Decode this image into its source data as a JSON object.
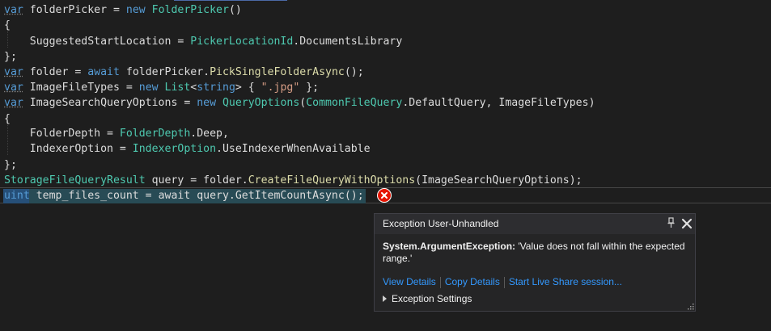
{
  "editor": {
    "lines": [
      {
        "tokens": [
          {
            "t": "var",
            "c": "squiggle-kw"
          },
          {
            "t": " folderPicker = ",
            "c": "plain"
          },
          {
            "t": "new",
            "c": "kw"
          },
          {
            "t": " ",
            "c": "plain"
          },
          {
            "t": "FolderPicker",
            "c": "type"
          },
          {
            "t": "()",
            "c": "plain"
          }
        ]
      },
      {
        "tokens": [
          {
            "t": "{",
            "c": "plain"
          }
        ]
      },
      {
        "tokens": [
          {
            "t": "    SuggestedStartLocation = ",
            "c": "plain"
          },
          {
            "t": "PickerLocationId",
            "c": "type"
          },
          {
            "t": ".DocumentsLibrary",
            "c": "plain"
          }
        ]
      },
      {
        "tokens": [
          {
            "t": "};",
            "c": "plain"
          }
        ]
      },
      {
        "tokens": [
          {
            "t": "var",
            "c": "squiggle-kw"
          },
          {
            "t": " folder = ",
            "c": "plain"
          },
          {
            "t": "await",
            "c": "kw"
          },
          {
            "t": " folderPicker.",
            "c": "plain"
          },
          {
            "t": "PickSingleFolderAsync",
            "c": "method"
          },
          {
            "t": "();",
            "c": "plain"
          }
        ]
      },
      {
        "tokens": [
          {
            "t": "var",
            "c": "squiggle-kw"
          },
          {
            "t": " ImageFileTypes = ",
            "c": "plain"
          },
          {
            "t": "new",
            "c": "kw"
          },
          {
            "t": " ",
            "c": "plain"
          },
          {
            "t": "List",
            "c": "type"
          },
          {
            "t": "<",
            "c": "plain"
          },
          {
            "t": "string",
            "c": "kw"
          },
          {
            "t": "> { ",
            "c": "plain"
          },
          {
            "t": "\".jpg\"",
            "c": "str"
          },
          {
            "t": " };",
            "c": "plain"
          }
        ]
      },
      {
        "tokens": [
          {
            "t": "var",
            "c": "squiggle-kw"
          },
          {
            "t": " ImageSearchQueryOptions = ",
            "c": "plain"
          },
          {
            "t": "new",
            "c": "kw"
          },
          {
            "t": " ",
            "c": "plain"
          },
          {
            "t": "QueryOptions",
            "c": "type"
          },
          {
            "t": "(",
            "c": "plain"
          },
          {
            "t": "CommonFileQuery",
            "c": "type"
          },
          {
            "t": ".DefaultQuery, ",
            "c": "plain"
          },
          {
            "t": "ImageFileTypes",
            "c": "plain"
          },
          {
            "t": ")",
            "c": "plain"
          }
        ]
      },
      {
        "tokens": [
          {
            "t": "{",
            "c": "plain"
          }
        ]
      },
      {
        "tokens": [
          {
            "t": "    FolderDepth = ",
            "c": "plain"
          },
          {
            "t": "FolderDepth",
            "c": "type"
          },
          {
            "t": ".Deep,",
            "c": "plain"
          }
        ]
      },
      {
        "tokens": [
          {
            "t": "    IndexerOption = ",
            "c": "plain"
          },
          {
            "t": "IndexerOption",
            "c": "type"
          },
          {
            "t": ".UseIndexerWhenAvailable",
            "c": "plain"
          }
        ]
      },
      {
        "tokens": [
          {
            "t": "};",
            "c": "plain"
          }
        ]
      },
      {
        "tokens": [
          {
            "t": "StorageFileQueryResult",
            "c": "type"
          },
          {
            "t": " query = folder.",
            "c": "plain"
          },
          {
            "t": "CreateFileQueryWithOptions",
            "c": "method"
          },
          {
            "t": "(ImageSearchQueryOptions);",
            "c": "plain"
          }
        ]
      },
      {
        "tokens": [
          {
            "t": "uint",
            "c": "kw"
          },
          {
            "t": " temp_files_count = ",
            "c": "plain"
          },
          {
            "t": "await",
            "c": "plain"
          },
          {
            "t": " query.",
            "c": "plain"
          },
          {
            "t": "GetItemCountAsync",
            "c": "plain"
          },
          {
            "t": "();",
            "c": "plain"
          }
        ]
      }
    ]
  },
  "exception_popup": {
    "title": "Exception User-Unhandled",
    "exception_type": "System.ArgumentException:",
    "message": " 'Value does not fall within the expected range.'",
    "links": {
      "view_details": "View Details",
      "copy_details": "Copy Details",
      "live_share": "Start Live Share session..."
    },
    "settings_label": "Exception Settings"
  },
  "icons": {
    "error": "error-icon",
    "pin": "pin-icon",
    "close": "close-icon",
    "expander": "expander-icon",
    "resize": "resize-grip-icon"
  },
  "colors": {
    "background": "#1e1e1e",
    "keyword": "#569cd6",
    "type": "#4ec9b0",
    "method": "#dcdcaa",
    "string": "#d69d85",
    "text": "#dcdcdc",
    "link": "#3399ff",
    "error": "#e51400",
    "statement_highlight": "#284b55"
  }
}
